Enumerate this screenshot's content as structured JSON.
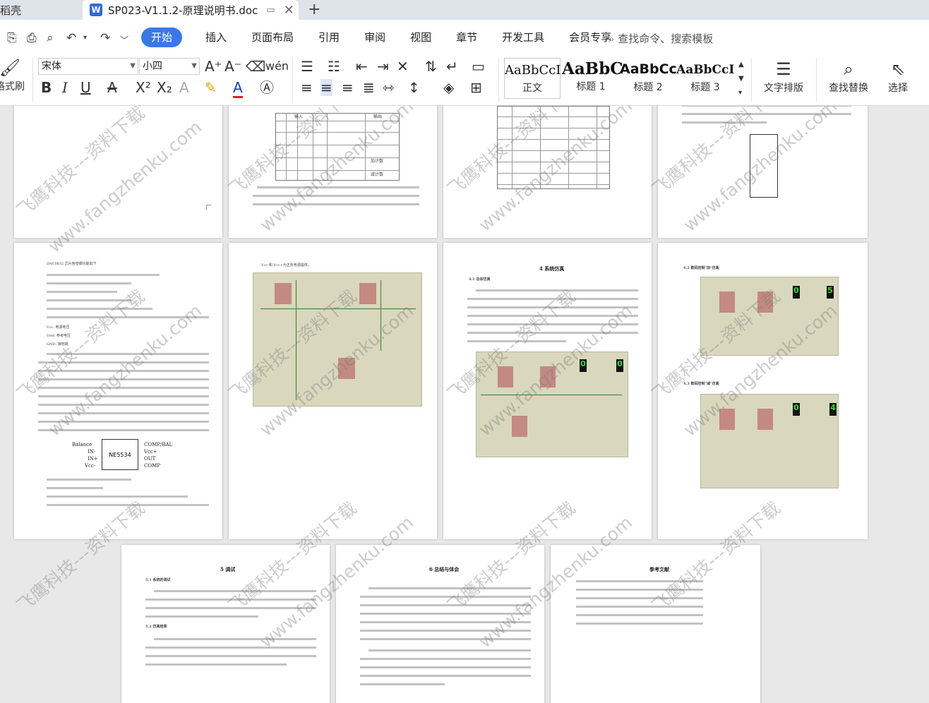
{
  "tabs": {
    "prev_label": "稻壳",
    "active_icon": "W",
    "active_title": "SP023-V1.1.2-原理说明书.doc",
    "new_tab": "+"
  },
  "menu": {
    "items": [
      "开始",
      "插入",
      "页面布局",
      "引用",
      "审阅",
      "视图",
      "章节",
      "开发工具",
      "会员专享"
    ],
    "search_placeholder": "查找命令、搜索模板"
  },
  "ribbon": {
    "format_painter": "格式刷",
    "font_name": "宋体",
    "font_size": "小四",
    "styles": [
      {
        "sample": "AaBbCcI",
        "name": "正文"
      },
      {
        "sample": "AaBbC",
        "name": "标题 1"
      },
      {
        "sample": "AaBbCc",
        "name": "标题 2"
      },
      {
        "sample": "AaBbCcI",
        "name": "标题 3"
      }
    ],
    "text_layout": "文字排版",
    "find_replace": "查找替换",
    "select": "选择"
  },
  "document": {
    "watermark_text": "飞鹰科技---资料下载",
    "watermark_url": "www.fangzhenku.com",
    "page_headings": {
      "p7": "4 系统仿真",
      "p7_sub": "4.1 总体仿真",
      "p8_sub1": "4.2 数码控制\"加\"仿真",
      "p8_sub2": "4.3 数码控制\"减\"仿真",
      "p9": "5 调试",
      "p9_sub1": "5.1 系统的调试",
      "p9_sub2": "5.2 仿真结果",
      "p10": "6 总结与体会",
      "p11": "参考文献"
    },
    "table_labels": {
      "input": "输入",
      "output": "输出",
      "add_count": "加计数",
      "sub_count": "减计数"
    },
    "chip_label": "NE5534",
    "chip_pins_left": [
      "Balance",
      "IN-",
      "IN+",
      "Vcc-"
    ],
    "chip_pins_right": [
      "COMP/BAL",
      "Vcc+",
      "OUT",
      "COMP"
    ],
    "page5_lines": [
      "DAC0832 芯片各管脚功能如下",
      "Vcc: 电源电压",
      "Vref: 参考电压",
      "GND: 接地端"
    ],
    "page6_caption": "Vcc-和 Vcc+为正负电源提供。"
  }
}
